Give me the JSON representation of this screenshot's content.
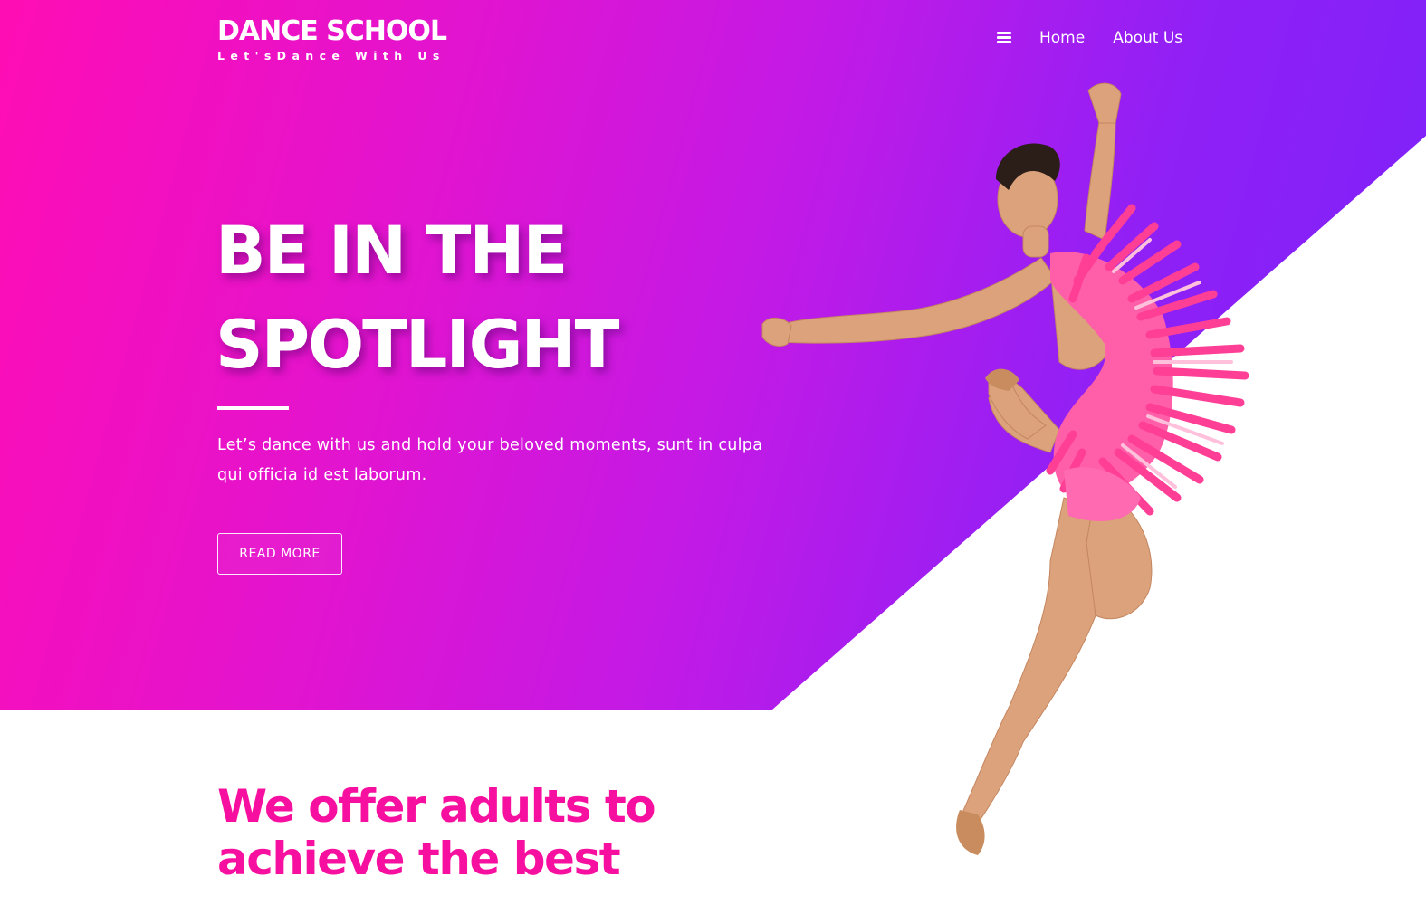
{
  "colors": {
    "gradient_start": "#ff0db4",
    "gradient_end": "#7a22fb",
    "accent_pink": "#f7109f",
    "text_light": "#ffffff",
    "background": "#ffffff"
  },
  "brand": {
    "title": "DANCE SCHOOL",
    "tagline": "Let'sDance With Us"
  },
  "nav": {
    "menu_icon": "hamburger-menu-icon",
    "links": [
      {
        "label": "Home"
      },
      {
        "label": "About Us"
      }
    ]
  },
  "hero": {
    "headline_line1": "BE IN THE",
    "headline_line2": "SPOTLIGHT",
    "description": "Let’s dance with us and hold your beloved moments, sunt in culpa qui officia id est laborum.",
    "cta_label": "READ MORE",
    "image": "dancer-in-pink-fringe-costume"
  },
  "offer": {
    "heading_line1": "We offer adults to",
    "heading_line2": "achieve the best"
  }
}
